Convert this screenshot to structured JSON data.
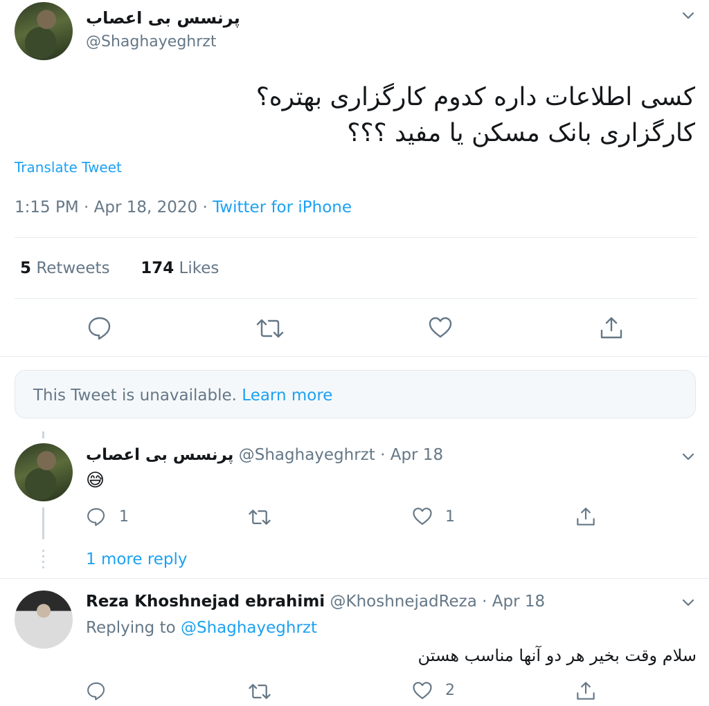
{
  "main_tweet": {
    "display_name": "پرنسس بی اعصاب",
    "handle": "@Shaghayeghrzt",
    "text_line1": "کسی اطلاعات داره کدوم کارگزاری بهتره؟",
    "text_line2": "کارگزاری بانک مسکن یا مفید ؟؟؟",
    "translate_label": "Translate Tweet",
    "time": "1:15 PM · Apr 18, 2020 · ",
    "source": "Twitter for iPhone",
    "retweet_count": "5",
    "retweet_label": " Retweets",
    "like_count": "174",
    "like_label": " Likes"
  },
  "unavailable": {
    "text": "This Tweet is unavailable. ",
    "link": "Learn more"
  },
  "reply1": {
    "display_name": "پرنسس بی اعصاب",
    "handle_date": "@Shaghayeghrzt · Apr 18",
    "emoji": "😅",
    "reply_count": "1",
    "like_count": "1",
    "more_replies": "1 more reply"
  },
  "reply2": {
    "display_name": "Reza Khoshnejad ebrahimi",
    "handle_date": "@KhoshnejadReza · Apr 18",
    "replying_to_label": "Replying to ",
    "replying_to_handle": "@Shaghayeghrzt",
    "text": "سلام وقت بخیر هر دو آنها مناسب هستن",
    "like_count": "2"
  },
  "icons": {
    "reply": "reply-icon",
    "retweet": "retweet-icon",
    "like": "heart-icon",
    "share": "share-icon",
    "more": "chevron-down-icon"
  },
  "colors": {
    "accent": "#1da1f2",
    "secondary_text": "#657786",
    "border": "#e6ecf0"
  }
}
